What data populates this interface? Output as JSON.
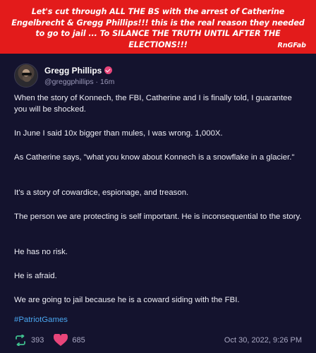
{
  "banner": {
    "text": "Let's cut through ALL THE BS with the arrest of Catherine Engelbrecht & Gregg Phillips!!! this is the real reason they needed to go to jail ... To SILANCE THE TRUTH UNTIL AFTER THE ELECTIONS!!!",
    "credit": "RnGFab"
  },
  "post": {
    "author_name": "Gregg Phillips",
    "handle_time": "@greggphillips · 16m",
    "paragraphs": [
      "When the story of Konnech, the FBI, Catherine and I is finally told, I guarantee you will be shocked.",
      "In June I said 10x bigger than mules, I was wrong. 1,000X.",
      "As Catherine says, \"what you know about Konnech is a snowflake in a glacier.\"",
      "It's a story of cowardice, espionage, and treason.",
      "The person we are protecting is self important. He is inconsequential to the story.",
      "He has no risk.",
      "He is afraid.",
      "We are going to jail because he is a coward siding with the FBI."
    ],
    "hashtag": "#PatriotGames",
    "reposts": "393",
    "likes": "685",
    "timestamp": "Oct 30, 2022, 9:26 PM"
  },
  "colors": {
    "banner": "#e31b1b",
    "card": "#14132e",
    "hashtag": "#4aa6f0",
    "repost": "#3fc08e",
    "like": "#e8457a"
  },
  "icons": [
    "avatar",
    "verified-badge-icon",
    "repost-icon",
    "heart-icon"
  ]
}
